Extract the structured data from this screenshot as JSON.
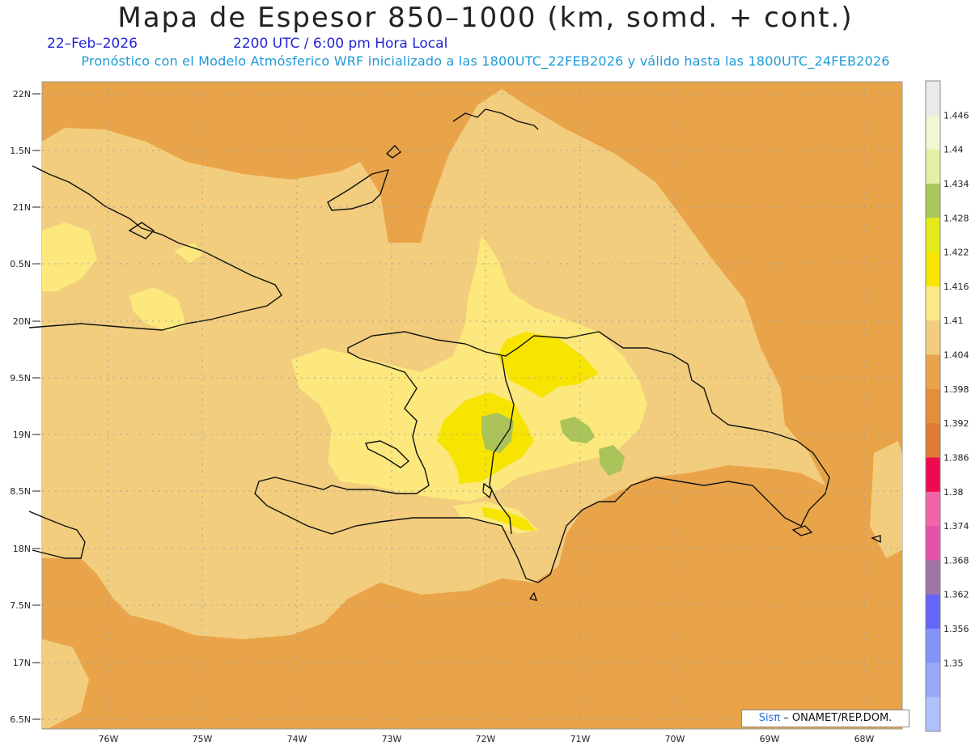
{
  "header": {
    "title": "Mapa de Espesor 850–1000 (km, somd. + cont.)",
    "date": "22–Feb–2026",
    "time": "2200 UTC / 6:00 pm Hora Local",
    "subtitle": "Pronóstico con el Modelo Atmósferico WRF inicializado a las 1800UTC_22FEB2026 y válido hasta las  1800UTC_24FEB2026"
  },
  "map": {
    "lat_labels": [
      "22N",
      "1.5N",
      "21N",
      "0.5N",
      "20N",
      "9.5N",
      "19N",
      "8.5N",
      "18N",
      "7.5N",
      "17N",
      "6.5N"
    ],
    "lon_labels": [
      "76W",
      "75W",
      "74W",
      "73W",
      "72W",
      "71W",
      "70W",
      "69W",
      "68W"
    ],
    "colors": {
      "ocean": "#e9a449",
      "land_base": "#f2cd7d",
      "band_1_41": "#fce87c",
      "band_1_416": "#f7e400",
      "band_1_428": "#aac45a",
      "coastline": "#111111"
    }
  },
  "colorbar": {
    "labels": [
      "1.446",
      "1.44",
      "1.434",
      "1.428",
      "1.422",
      "1.416",
      "1.41",
      "1.404",
      "1.398",
      "1.392",
      "1.386",
      "1.38",
      "1.374",
      "1.368",
      "1.362",
      "1.356",
      "1.35"
    ],
    "colors": [
      "#eaeaea",
      "#f2f6d2",
      "#e2f1a4",
      "#a8c85a",
      "#e4ea1a",
      "#f8e600",
      "#fee98a",
      "#f2cd7d",
      "#eba249",
      "#e48e3a",
      "#e07a34",
      "#ee0a4e",
      "#f064a8",
      "#e652a8",
      "#a275a8",
      "#6565f8",
      "#8492fa",
      "#9aa8fc",
      "#b0c0fc"
    ]
  },
  "credit": {
    "sis": "Sis",
    "pi": "π",
    "rest": " – ONAMET/REP.DOM."
  }
}
